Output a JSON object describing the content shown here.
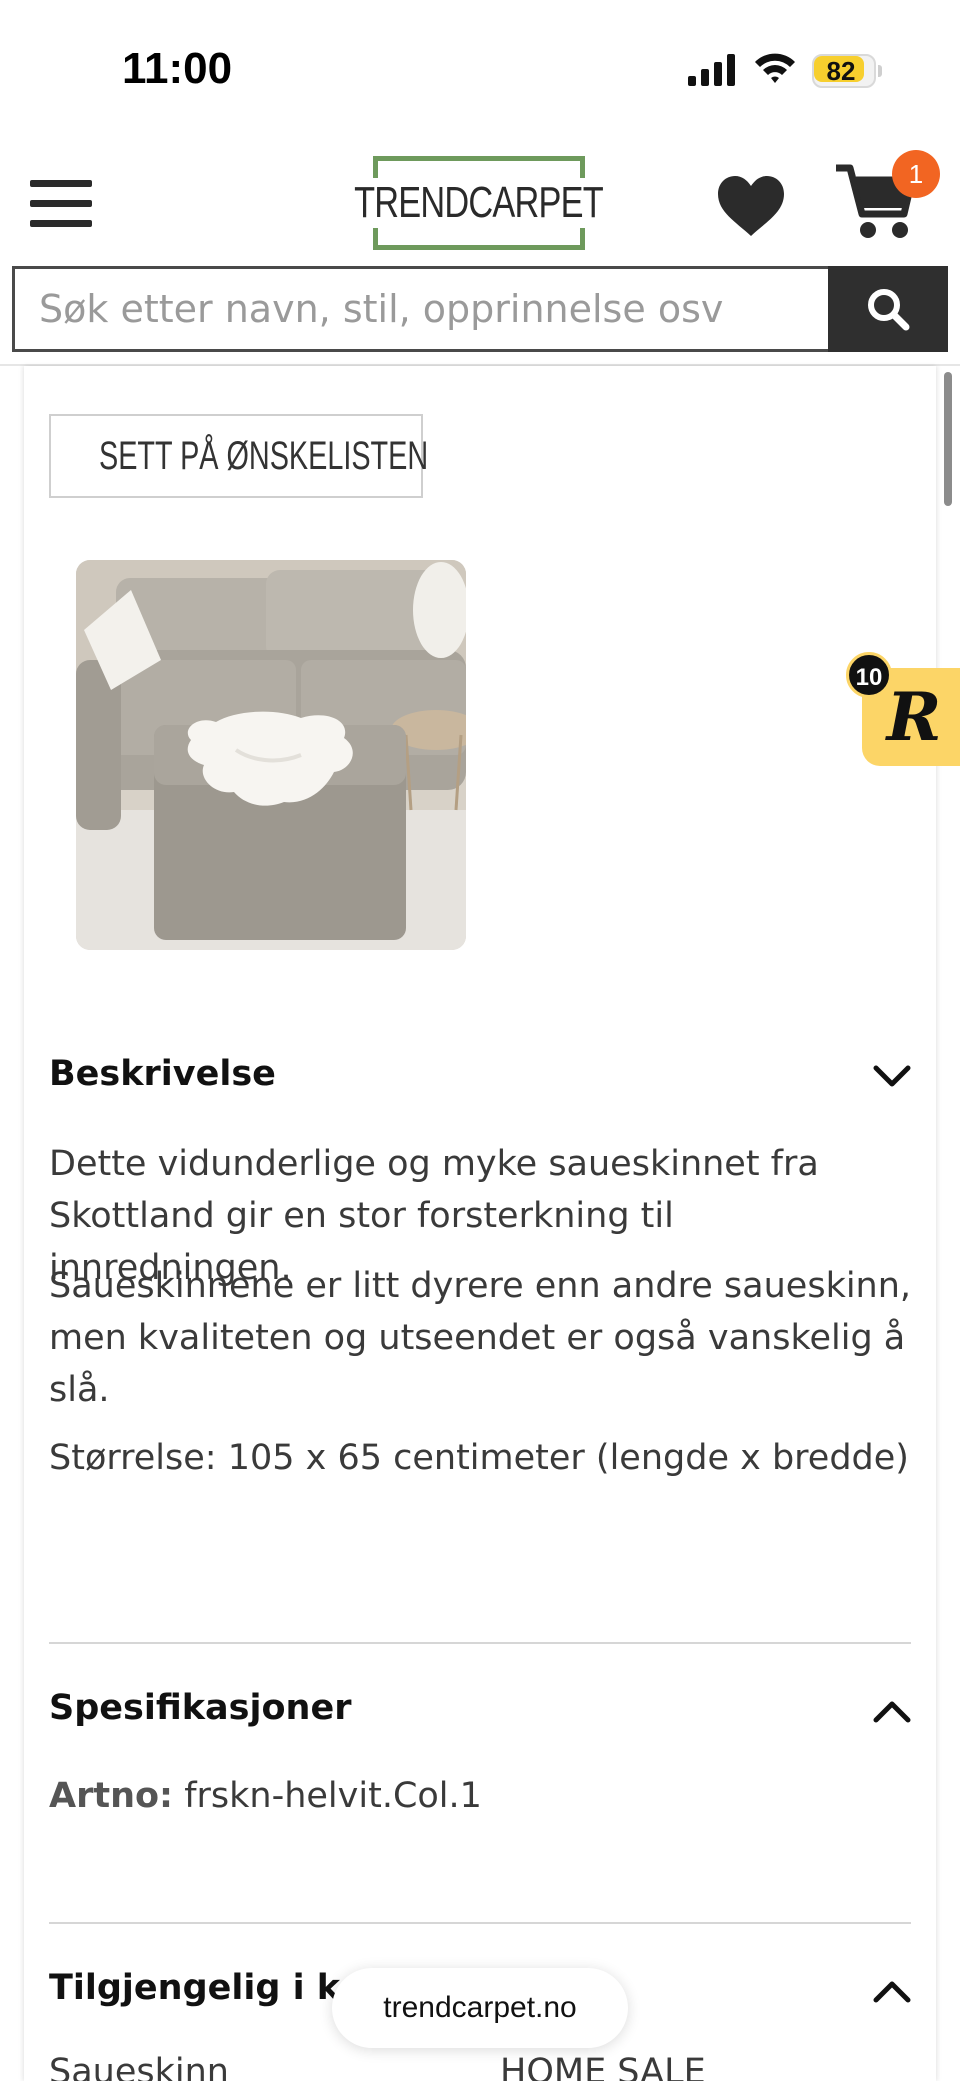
{
  "status_bar": {
    "time": "11:00",
    "battery_level": "82",
    "icons": [
      "signal-icon",
      "wifi-icon",
      "battery-icon"
    ]
  },
  "header": {
    "logo_text": "TRENDCARPET",
    "cart_count": "1",
    "icons": [
      "menu-icon",
      "heart-icon",
      "cart-icon"
    ]
  },
  "search": {
    "placeholder": "Søk etter navn, stil, opprinnelse osv",
    "button_icon": "search-icon"
  },
  "product": {
    "wishlist_label": "SETT PÅ ØNSKELISTEN",
    "image_alt": "Sofa med hvitt saueskinn"
  },
  "description": {
    "title": "Beskrivelse",
    "paragraphs": [
      "Dette vidunderlige og myke saueskinnet fra Skottland gir en stor forsterkning til innredningen.",
      "Saueskinnene er litt dyrere enn andre saueskinn, men kvaliteten og utseendet er også vanskelig å slå.",
      "Størrelse: 105 x 65 centimeter (lengde x bredde)"
    ]
  },
  "specifications": {
    "title": "Spesifikasjoner",
    "artno_label": "Artno:",
    "artno_value": "frskn-helvit.Col.1"
  },
  "categories": {
    "title": "Tilgjengelig i kat",
    "items": [
      "Saueskinn",
      "HOME SALE"
    ]
  },
  "floating_badge": {
    "letter": "R",
    "count": "10"
  },
  "browser": {
    "url": "trendcarpet.no"
  },
  "colors": {
    "logo_green": "#6e9a5c",
    "cart_badge": "#f26522",
    "battery": "#f7cf2e",
    "badge_yellow": "#fcd567",
    "search_button": "#2f2f2f"
  }
}
